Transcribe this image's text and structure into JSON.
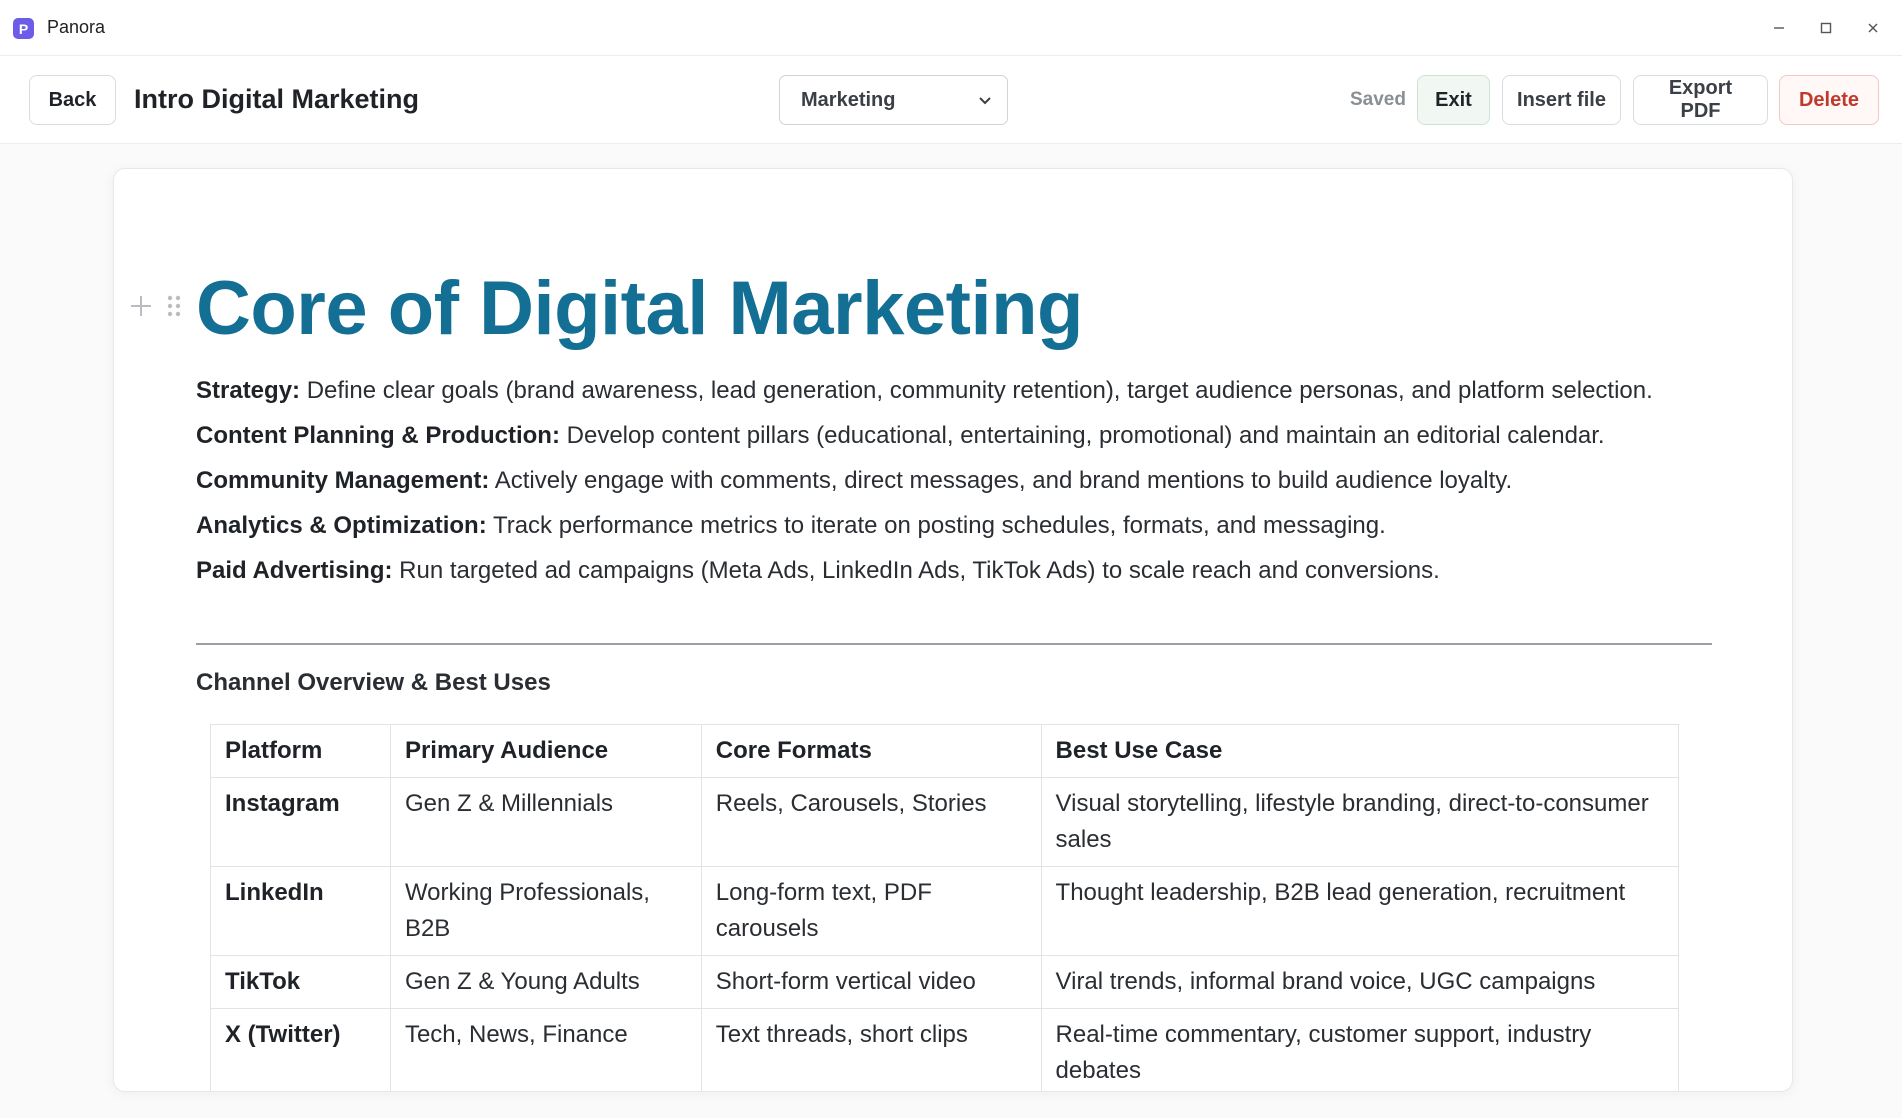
{
  "window": {
    "app_icon_letter": "P",
    "app_title": "Panora"
  },
  "toolbar": {
    "back_label": "Back",
    "doc_title": "Intro Digital Marketing",
    "category_selected": "Marketing",
    "save_status": "Saved",
    "exit_label": "Exit",
    "insert_label": "Insert file",
    "export_label": "Export PDF",
    "delete_label": "Delete"
  },
  "document": {
    "heading": "Core of Digital Marketing",
    "bullets": [
      {
        "term": "Strategy:",
        "text": " Define clear goals (brand awareness, lead generation, community retention), target audience personas, and platform selection."
      },
      {
        "term": "Content Planning & Production:",
        "text": " Develop content pillars (educational, entertaining, promotional) and maintain an editorial calendar."
      },
      {
        "term": "Community Management:",
        "text": " Actively engage with comments, direct messages, and brand mentions to build audience loyalty."
      },
      {
        "term": "Analytics & Optimization:",
        "text": " Track performance metrics to iterate on posting schedules, formats, and messaging."
      },
      {
        "term": "Paid Advertising:",
        "text": " Run targeted ad campaigns (Meta Ads, LinkedIn Ads, TikTok Ads) to scale reach and conversions."
      }
    ],
    "section_title": "Channel Overview & Best Uses",
    "table": {
      "headers": [
        "Platform",
        "Primary Audience",
        "Core Formats",
        "Best Use Case"
      ],
      "rows": [
        [
          "Instagram",
          "Gen Z & Millennials",
          "Reels, Carousels, Stories",
          "Visual storytelling, lifestyle branding, direct-to-consumer sales"
        ],
        [
          "LinkedIn",
          "Working Professionals, B2B",
          "Long-form text, PDF carousels",
          "Thought leadership, B2B lead generation, recruitment"
        ],
        [
          "TikTok",
          "Gen Z & Young Adults",
          "Short-form vertical video",
          "Viral trends, informal brand voice, UGC campaigns"
        ],
        [
          "X (Twitter)",
          "Tech, News, Finance",
          "Text threads, short clips",
          "Real-time commentary, customer support, industry debates"
        ]
      ]
    }
  },
  "colors": {
    "heading": "#136f93",
    "app_icon": "#6c5ce7",
    "delete": "#c0392b",
    "exit_bg": "#f1f8f3"
  },
  "icons": {
    "app": "panora-logo-icon",
    "minimize": "minimize-icon",
    "maximize": "maximize-icon",
    "close": "close-icon",
    "select": "chevron-down-icon",
    "add_block": "plus-icon",
    "drag": "drag-handle-icon"
  }
}
